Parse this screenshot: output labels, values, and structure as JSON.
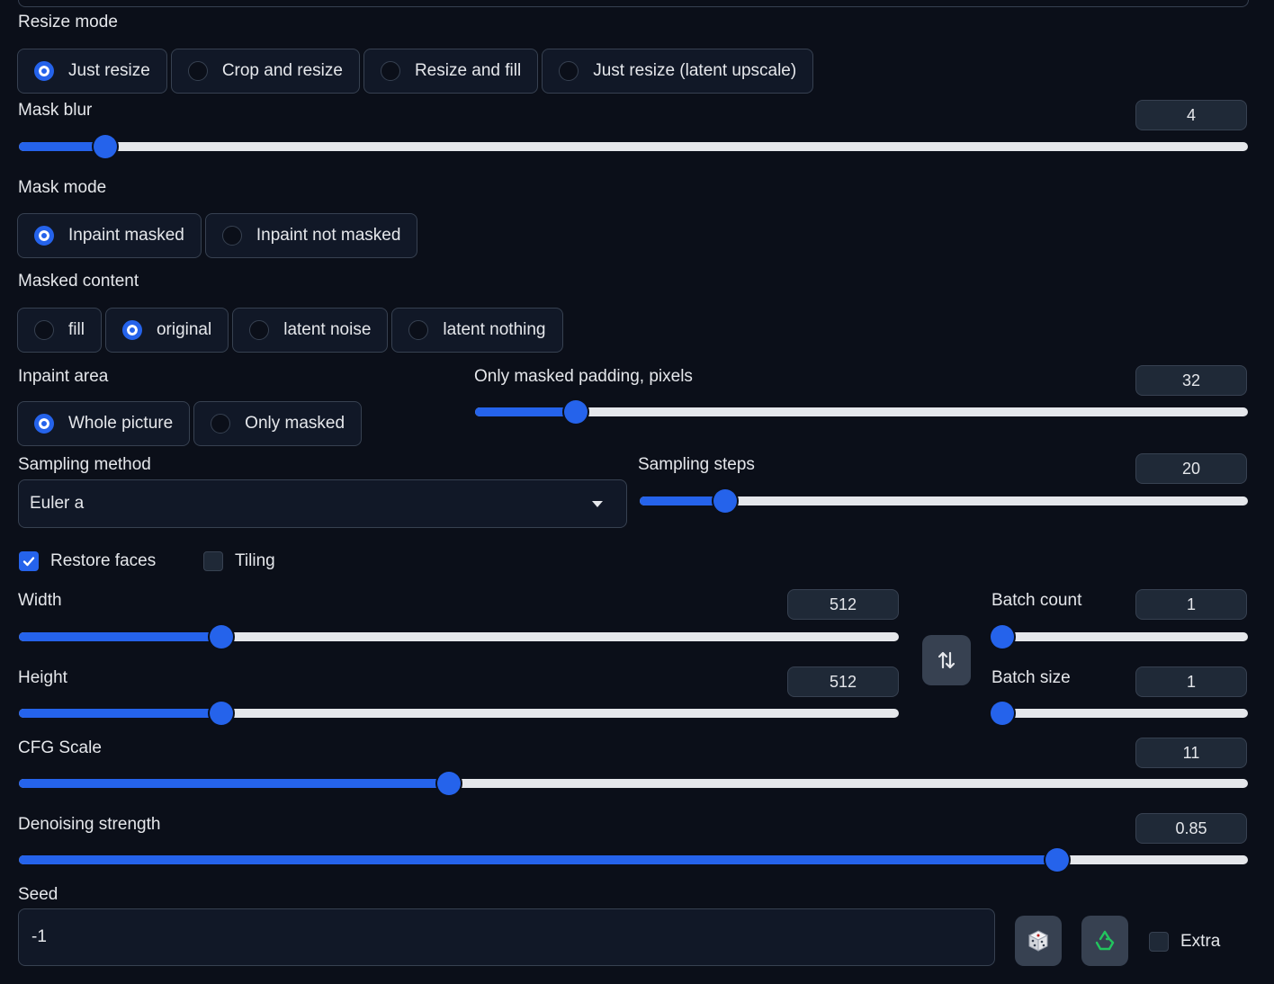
{
  "resize_mode": {
    "label": "Resize mode",
    "options": [
      "Just resize",
      "Crop and resize",
      "Resize and fill",
      "Just resize (latent upscale)"
    ],
    "selected": "Just resize"
  },
  "mask_blur": {
    "label": "Mask blur",
    "value": "4",
    "fraction": 0.07
  },
  "mask_mode": {
    "label": "Mask mode",
    "options": [
      "Inpaint masked",
      "Inpaint not masked"
    ],
    "selected": "Inpaint masked"
  },
  "masked_content": {
    "label": "Masked content",
    "options": [
      "fill",
      "original",
      "latent noise",
      "latent nothing"
    ],
    "selected": "original"
  },
  "inpaint_area": {
    "label": "Inpaint area",
    "options": [
      "Whole picture",
      "Only masked"
    ],
    "selected": "Whole picture"
  },
  "only_masked_padding": {
    "label": "Only masked padding, pixels",
    "value": "32",
    "fraction": 0.13
  },
  "sampling_method": {
    "label": "Sampling method",
    "value": "Euler a"
  },
  "sampling_steps": {
    "label": "Sampling steps",
    "value": "20",
    "fraction": 0.14
  },
  "restore_faces": {
    "label": "Restore faces",
    "checked": true
  },
  "tiling": {
    "label": "Tiling",
    "checked": false
  },
  "width": {
    "label": "Width",
    "value": "512",
    "fraction": 0.23
  },
  "height": {
    "label": "Height",
    "value": "512",
    "fraction": 0.23
  },
  "batch_count": {
    "label": "Batch count",
    "value": "1",
    "fraction": 0.0
  },
  "batch_size": {
    "label": "Batch size",
    "value": "1",
    "fraction": 0.0
  },
  "cfg_scale": {
    "label": "CFG Scale",
    "value": "11",
    "fraction": 0.35
  },
  "denoising_strength": {
    "label": "Denoising strength",
    "value": "0.85",
    "fraction": 0.845
  },
  "seed": {
    "label": "Seed",
    "value": "-1"
  },
  "extra": {
    "label": "Extra",
    "checked": false
  },
  "icons": {
    "swap": "swap-dimensions-icon",
    "dice": "dice-icon",
    "recycle": "recycle-icon"
  },
  "colors": {
    "accent": "#2563eb",
    "background": "#0b0f19",
    "panel": "#111827",
    "track": "#e5e7eb"
  }
}
